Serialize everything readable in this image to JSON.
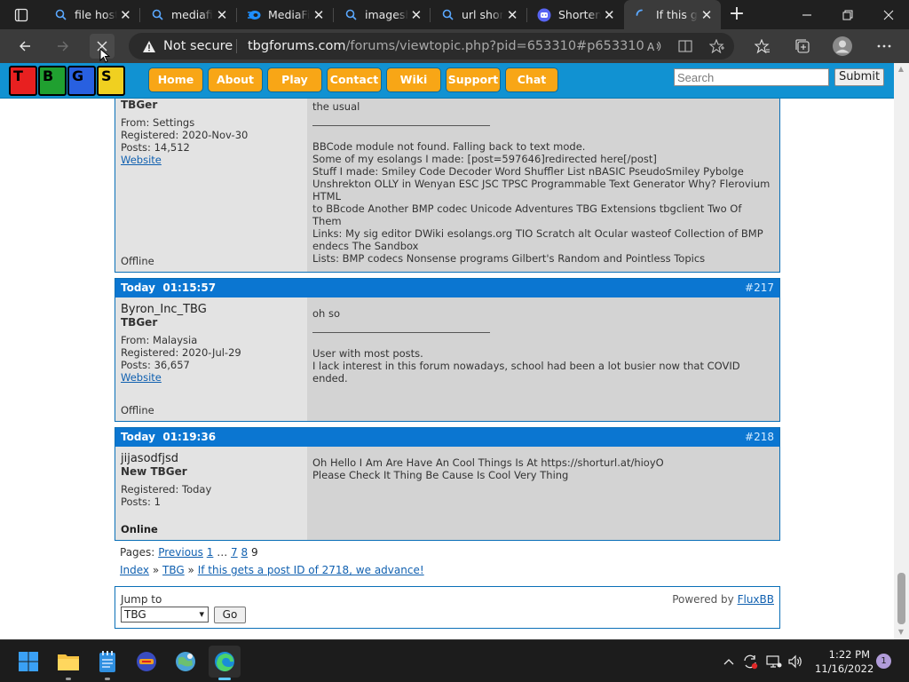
{
  "browser": {
    "tabs": [
      {
        "title": "file host",
        "icon": "search-icon"
      },
      {
        "title": "mediafi",
        "icon": "search-icon"
      },
      {
        "title": "MediaFi",
        "icon": "mediafire-icon"
      },
      {
        "title": "imagesh",
        "icon": "search-icon"
      },
      {
        "title": "url shor",
        "icon": "search-icon"
      },
      {
        "title": "Shorten",
        "icon": "discord-icon"
      },
      {
        "title": "If this g",
        "icon": "loading-icon",
        "active": true
      }
    ],
    "security_label": "Not secure",
    "url_host": "tbgforums.com",
    "url_path": "/forums/viewtopic.php?pid=653310#p653310"
  },
  "site": {
    "logo_letters": [
      "T",
      "B",
      "G",
      "S"
    ],
    "nav": [
      "Home",
      "About",
      "Play",
      "Contact",
      "Wiki",
      "Support",
      "Chat"
    ],
    "search_placeholder": "Search",
    "search_submit": "Submit"
  },
  "posts": [
    {
      "partial": true,
      "user_title": "TBGer",
      "from": "From: Settings",
      "registered": "Registered: 2020-Nov-30",
      "posts": "Posts: 14,512",
      "website": "Website",
      "status": "Offline",
      "message": "the usual",
      "signature": [
        "BBCode module not found. Falling back to text mode.",
        "Some of my esolangs I made: [post=597646]redirected here[/post]",
        "Stuff I made: Smiley Code Decoder Word Shuffler List nBASIC PseudoSmiley Pybolge",
        "Unshrekton OLLY in Wenyan ESC JSC TPSC Programmable Text Generator Why? Flerovium HTML",
        "to BBcode Another BMP codec Unicode Adventures TBG Extensions tbgclient Two Of Them",
        "Links: My sig editor DWiki esolangs.org TIO Scratch alt Ocular wasteof Collection of BMP",
        "endecs The Sandbox",
        "Lists: BMP codecs Nonsense programs Gilbert's Random and Pointless Topics"
      ]
    },
    {
      "date": "Today",
      "time": "01:15:57",
      "number": "#217",
      "username": "Byron_Inc_TBG",
      "user_title": "TBGer",
      "from": "From: Malaysia",
      "registered": "Registered: 2020-Jul-29",
      "posts": "Posts: 36,657",
      "website": "Website",
      "status": "Offline",
      "message": "oh so",
      "signature": [
        "User with most posts.",
        "I lack interest in this forum nowadays, school had been a lot busier now that COVID ended."
      ]
    },
    {
      "date": "Today",
      "time": "01:19:36",
      "number": "#218",
      "username": "jijasodfjsd",
      "user_title": "New TBGer",
      "registered": "Registered: Today",
      "posts": "Posts: 1",
      "status": "Online",
      "message_lines": [
        "Oh Hello I Am Are Have An Cool Things Is At https://shorturl.at/hioyO",
        "Please Check It Thing Be Cause Is Cool Very Thing"
      ]
    }
  ],
  "pagination": {
    "label": "Pages:",
    "previous": "Previous",
    "first": "1",
    "ellipsis": "…",
    "p7": "7",
    "p8": "8",
    "current": "9"
  },
  "breadcrumb": {
    "index": "Index",
    "forum": "TBG",
    "topic": "If this gets a post ID of 2718, we advance!",
    "sep": "»"
  },
  "footer": {
    "jump_label": "Jump to",
    "jump_value": "TBG",
    "go": "Go",
    "powered_by": "Powered by",
    "fluxbb": "FluxBB"
  },
  "taskbar": {
    "time": "1:22 PM",
    "date": "11/16/2022",
    "notifications": "1"
  }
}
